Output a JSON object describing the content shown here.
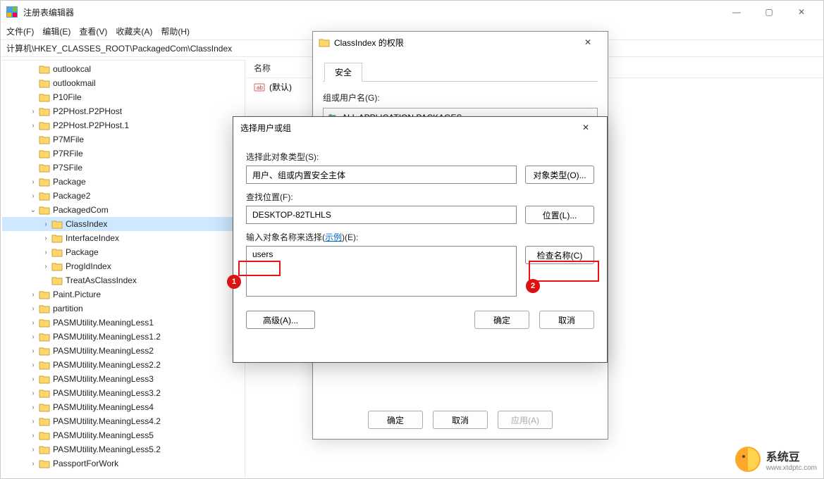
{
  "app": {
    "title": "注册表编辑器"
  },
  "menu": {
    "file": "文件(F)",
    "edit": "编辑(E)",
    "view": "查看(V)",
    "favorites": "收藏夹(A)",
    "help": "帮助(H)"
  },
  "address": {
    "path": "计算机\\HKEY_CLASSES_ROOT\\PackagedCom\\ClassIndex"
  },
  "list": {
    "header_name": "名称",
    "default_row": "(默认)"
  },
  "tree": {
    "items": [
      {
        "depth": 2,
        "exp": "",
        "label": "outlookcal"
      },
      {
        "depth": 2,
        "exp": "",
        "label": "outlookmail"
      },
      {
        "depth": 2,
        "exp": "",
        "label": "P10File"
      },
      {
        "depth": 2,
        "exp": ">",
        "label": "P2PHost.P2PHost"
      },
      {
        "depth": 2,
        "exp": ">",
        "label": "P2PHost.P2PHost.1"
      },
      {
        "depth": 2,
        "exp": "",
        "label": "P7MFile"
      },
      {
        "depth": 2,
        "exp": "",
        "label": "P7RFile"
      },
      {
        "depth": 2,
        "exp": "",
        "label": "P7SFile"
      },
      {
        "depth": 2,
        "exp": ">",
        "label": "Package"
      },
      {
        "depth": 2,
        "exp": ">",
        "label": "Package2"
      },
      {
        "depth": 2,
        "exp": "v",
        "label": "PackagedCom"
      },
      {
        "depth": 3,
        "exp": ">",
        "label": "ClassIndex",
        "selected": true
      },
      {
        "depth": 3,
        "exp": ">",
        "label": "InterfaceIndex"
      },
      {
        "depth": 3,
        "exp": ">",
        "label": "Package"
      },
      {
        "depth": 3,
        "exp": ">",
        "label": "ProgIdIndex"
      },
      {
        "depth": 3,
        "exp": "",
        "label": "TreatAsClassIndex"
      },
      {
        "depth": 2,
        "exp": ">",
        "label": "Paint.Picture"
      },
      {
        "depth": 2,
        "exp": ">",
        "label": "partition"
      },
      {
        "depth": 2,
        "exp": ">",
        "label": "PASMUtility.MeaningLess1"
      },
      {
        "depth": 2,
        "exp": ">",
        "label": "PASMUtility.MeaningLess1.2"
      },
      {
        "depth": 2,
        "exp": ">",
        "label": "PASMUtility.MeaningLess2"
      },
      {
        "depth": 2,
        "exp": ">",
        "label": "PASMUtility.MeaningLess2.2"
      },
      {
        "depth": 2,
        "exp": ">",
        "label": "PASMUtility.MeaningLess3"
      },
      {
        "depth": 2,
        "exp": ">",
        "label": "PASMUtility.MeaningLess3.2"
      },
      {
        "depth": 2,
        "exp": ">",
        "label": "PASMUtility.MeaningLess4"
      },
      {
        "depth": 2,
        "exp": ">",
        "label": "PASMUtility.MeaningLess4.2"
      },
      {
        "depth": 2,
        "exp": ">",
        "label": "PASMUtility.MeaningLess5"
      },
      {
        "depth": 2,
        "exp": ">",
        "label": "PASMUtility.MeaningLess5.2"
      },
      {
        "depth": 2,
        "exp": ">",
        "label": "PassportForWork"
      }
    ]
  },
  "perm_dialog": {
    "title": "ClassIndex 的权限",
    "tab_security": "安全",
    "label_users": "组或用户名(G):",
    "user_row": "ALL APPLICATION PACKAGES",
    "btn_ok": "确定",
    "btn_cancel": "取消",
    "btn_apply": "应用(A)"
  },
  "select_dialog": {
    "title": "选择用户或组",
    "label_object_type": "选择此对象类型(S):",
    "object_type_value": "用户、组或内置安全主体",
    "btn_object_types": "对象类型(O)...",
    "label_location": "查找位置(F):",
    "location_value": "DESKTOP-82TLHLS",
    "btn_locations": "位置(L)...",
    "label_names_prefix": "输入对象名称来选择(",
    "label_names_link": "示例",
    "label_names_suffix": ")(E):",
    "names_value": "users",
    "btn_check_names": "检查名称(C)",
    "btn_advanced": "高级(A)...",
    "btn_ok": "确定",
    "btn_cancel": "取消"
  },
  "annotations": {
    "marker1": "1",
    "marker2": "2"
  },
  "watermark": {
    "brand": "系统豆",
    "url": "www.xtdptc.com"
  }
}
